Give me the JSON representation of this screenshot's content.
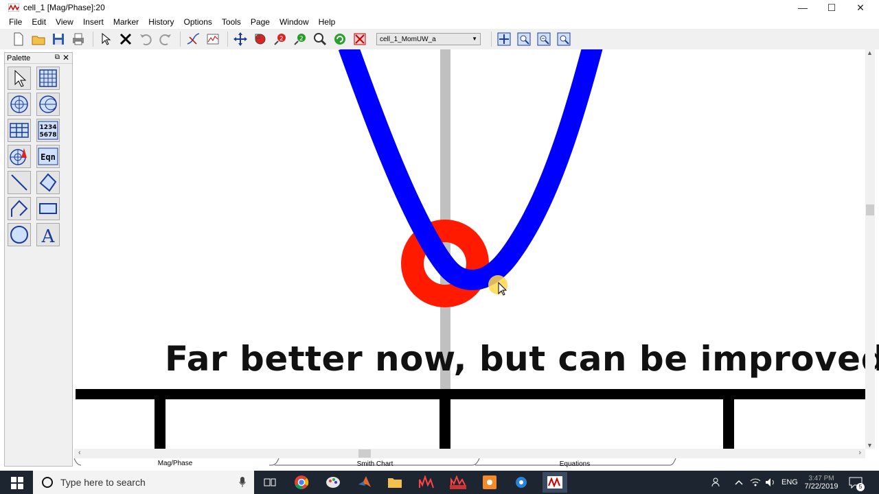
{
  "window": {
    "title": "cell_1 [Mag/Phase]:20",
    "minimize": "—",
    "maximize": "☐",
    "close": "✕"
  },
  "menu": [
    "File",
    "Edit",
    "View",
    "Insert",
    "Marker",
    "History",
    "Options",
    "Tools",
    "Page",
    "Window",
    "Help"
  ],
  "toolbar": {
    "graph_select_value": "cell_1_MomUW_a",
    "graph_select_arrow": "▼"
  },
  "palette": {
    "title": "Palette",
    "float_glyph": "⧉",
    "close_glyph": "✕",
    "tools": [
      "pointer",
      "grid",
      "polar",
      "smith",
      "table",
      "1234\n5678",
      "antenna",
      "Eqn",
      "line",
      "polygon",
      "polyline",
      "rectangle",
      "circle",
      "A"
    ],
    "number_tool_line1": "1234",
    "number_tool_line2": "5678",
    "eqn_label": "Eqn",
    "text_label": "A"
  },
  "caption": "Far better now, but can be improved.",
  "tabs": [
    "Mag/Phase",
    "Smith Chart",
    "Equations"
  ],
  "scroll": {
    "left": "‹",
    "right": "›",
    "up": "▲",
    "down": "▼"
  },
  "taskbar": {
    "search_placeholder": "Type here to search",
    "language": "ENG",
    "time": "3:47 PM",
    "date": "7/22/2019",
    "notification_count": "5"
  },
  "colors": {
    "curve": "#0000ff",
    "marker": "#ff1a00",
    "cursor_halo": "#ffd84a",
    "axis_gray": "#c0c0c0",
    "taskbar": "#1c2530"
  }
}
